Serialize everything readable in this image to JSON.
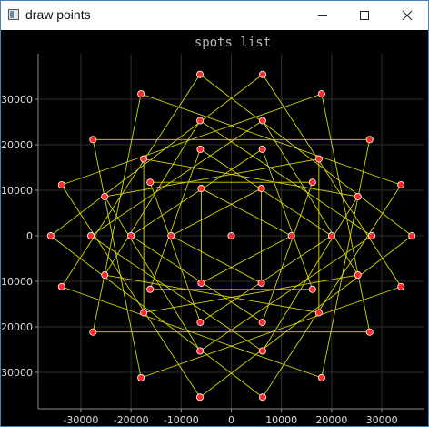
{
  "window": {
    "title": "draw points",
    "icon": "app-window-icon",
    "controls": {
      "minimize": "minimize-icon",
      "maximize": "maximize-icon",
      "close": "close-icon"
    }
  },
  "chart_data": {
    "type": "scatter",
    "title": "spots list",
    "xlabel": "",
    "ylabel": "",
    "xlim": [
      -38500,
      38500
    ],
    "ylim": [
      -38000,
      40000
    ],
    "x_ticks": [
      -30000,
      -20000,
      -10000,
      0,
      10000,
      20000,
      30000
    ],
    "y_ticks": [
      -30000,
      -20000,
      -10000,
      0,
      10000,
      20000,
      30000
    ],
    "grid": true,
    "legend": "none",
    "colors": {
      "background": "#000000",
      "line": "#d8d800",
      "marker": "#ff2a2a",
      "marker_edge": "#ffffff",
      "grid": "#2e2e2e",
      "axis": "#8a8a8a"
    },
    "series": [
      {
        "rings": [
          {
            "radius": 36000,
            "count": 18,
            "step": 5
          },
          {
            "radius": 28000,
            "count": 14,
            "step": 4
          },
          {
            "radius": 20000,
            "count": 10,
            "step": 3
          },
          {
            "radius": 12000,
            "count": 6,
            "step": 2
          }
        ],
        "points": [
          [
            36000,
            0
          ],
          [
            33829,
            11173
          ],
          [
            27577,
            21139
          ],
          [
            18000,
            31177
          ],
          [
            6251,
            35453
          ],
          [
            -6251,
            35453
          ],
          [
            -18000,
            31177
          ],
          [
            -27577,
            21139
          ],
          [
            -33829,
            11173
          ],
          [
            -36000,
            0
          ],
          [
            -33829,
            -11173
          ],
          [
            -27577,
            -21139
          ],
          [
            -18000,
            -31177
          ],
          [
            -6251,
            -35453
          ],
          [
            6251,
            -35453
          ],
          [
            18000,
            -31177
          ],
          [
            27577,
            -21139
          ],
          [
            33829,
            -11173
          ],
          [
            28000,
            0
          ],
          [
            25227,
            8606
          ],
          [
            17457,
            16891
          ],
          [
            6231,
            25298
          ],
          [
            -6231,
            25298
          ],
          [
            -17457,
            16891
          ],
          [
            -25227,
            8606
          ],
          [
            -28000,
            0
          ],
          [
            -25227,
            -8606
          ],
          [
            -17457,
            -16891
          ],
          [
            -6231,
            -25298
          ],
          [
            6231,
            -25298
          ],
          [
            17457,
            -16891
          ],
          [
            25227,
            -8606
          ],
          [
            20000,
            0
          ],
          [
            16180,
            11756
          ],
          [
            6180,
            19021
          ],
          [
            -6180,
            19021
          ],
          [
            -16180,
            11756
          ],
          [
            -20000,
            0
          ],
          [
            -16180,
            -11756
          ],
          [
            -6180,
            -19021
          ],
          [
            6180,
            -19021
          ],
          [
            16180,
            -11756
          ],
          [
            12000,
            0
          ],
          [
            6000,
            10392
          ],
          [
            -6000,
            10392
          ],
          [
            -12000,
            0
          ],
          [
            -6000,
            -10392
          ],
          [
            6000,
            -10392
          ],
          [
            0,
            0
          ]
        ]
      }
    ]
  }
}
